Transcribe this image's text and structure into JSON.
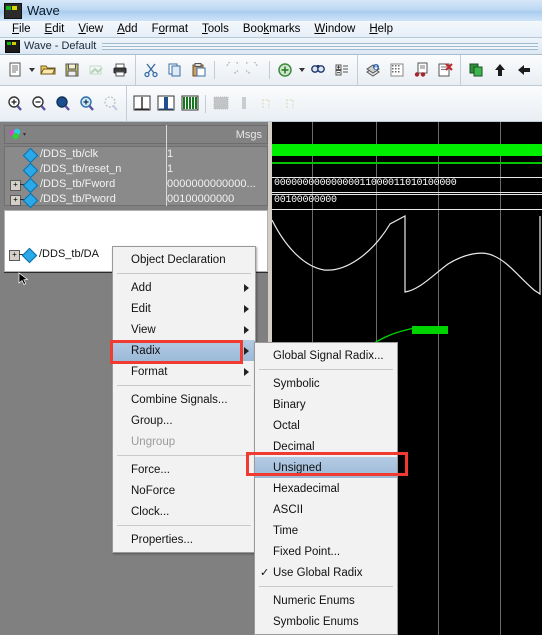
{
  "window": {
    "title": "Wave",
    "icon": "modelsim-icon",
    "document_tab": "Wave - Default"
  },
  "menubar": {
    "items": [
      {
        "label": "File",
        "mnemonic": "F"
      },
      {
        "label": "Edit",
        "mnemonic": "E"
      },
      {
        "label": "View",
        "mnemonic": "V"
      },
      {
        "label": "Add",
        "mnemonic": "A"
      },
      {
        "label": "Format",
        "mnemonic": "o"
      },
      {
        "label": "Tools",
        "mnemonic": "T"
      },
      {
        "label": "Bookmarks",
        "mnemonic": "k"
      },
      {
        "label": "Window",
        "mnemonic": "W"
      },
      {
        "label": "Help",
        "mnemonic": "H"
      }
    ]
  },
  "toolbar_main": {
    "icons": [
      "new-file-icon",
      "new-file-dropdown-icon",
      "open-folder-icon",
      "save-icon",
      "reload-icon",
      "print-icon",
      "cut-icon",
      "copy-icon",
      "paste-icon",
      "undo-icon",
      "redo-icon",
      "add-signal-icon",
      "add-signal-dropdown-icon",
      "find-icon",
      "expand-collapse-icon",
      "insert-wave-icon",
      "grid-icon",
      "annotate-icon",
      "delete-marker-icon",
      "copy-window-icon",
      "up-arrow-icon",
      "left-arrow-icon"
    ]
  },
  "toolbar_zoom": {
    "icons": [
      "zoom-in-icon",
      "zoom-out-icon",
      "zoom-full-icon",
      "zoom-cursor-icon",
      "zoom-range-icon",
      "cursor-icon",
      "wave-bar-icon",
      "wave-bars-icon",
      "dither-icon",
      "dither-small-icon",
      "step-icon",
      "step-alt-icon"
    ]
  },
  "wave_panel": {
    "header": {
      "msgs_label": "Msgs",
      "path_button": "path-selector-icon"
    },
    "signals": [
      {
        "name": "/DDS_tb/clk",
        "value": "1",
        "expandable": false,
        "wave_type": "bus-green"
      },
      {
        "name": "/DDS_tb/reset_n",
        "value": "1",
        "expandable": false,
        "wave_type": "bus-green"
      },
      {
        "name": "/DDS_tb/Fword",
        "value": "0000000000000...",
        "expandable": true,
        "wave_type": "bus"
      },
      {
        "name": "/DDS_tb/Pword",
        "value": "00100000000",
        "expandable": true,
        "wave_type": "bus"
      },
      {
        "name": "/DDS_tb/DA",
        "value": "",
        "expandable": true,
        "wave_type": "analog"
      }
    ],
    "wave_values": {
      "fword": "00000000000000011000011010100000",
      "pword": "00100000000"
    }
  },
  "context_menu": {
    "items": [
      {
        "label": "Object Declaration",
        "submenu": false,
        "disabled": false,
        "checked": false
      },
      {
        "separator": true
      },
      {
        "label": "Add",
        "submenu": true,
        "disabled": false,
        "checked": false
      },
      {
        "label": "Edit",
        "submenu": true,
        "disabled": false,
        "checked": false
      },
      {
        "label": "View",
        "submenu": true,
        "disabled": false,
        "checked": false
      },
      {
        "label": "Radix",
        "submenu": true,
        "disabled": false,
        "checked": false,
        "selected": true
      },
      {
        "label": "Format",
        "submenu": true,
        "disabled": false,
        "checked": false
      },
      {
        "separator": true
      },
      {
        "label": "Combine Signals...",
        "submenu": false,
        "disabled": false,
        "checked": false
      },
      {
        "label": "Group...",
        "submenu": false,
        "disabled": false,
        "checked": false
      },
      {
        "label": "Ungroup",
        "submenu": false,
        "disabled": true,
        "checked": false
      },
      {
        "separator": true
      },
      {
        "label": "Force...",
        "submenu": false,
        "disabled": false,
        "checked": false
      },
      {
        "label": "NoForce",
        "submenu": false,
        "disabled": false,
        "checked": false
      },
      {
        "label": "Clock...",
        "submenu": false,
        "disabled": false,
        "checked": false
      },
      {
        "separator": true
      },
      {
        "label": "Properties...",
        "submenu": false,
        "disabled": false,
        "checked": false
      }
    ]
  },
  "radix_submenu": {
    "items": [
      {
        "label": "Global Signal Radix...",
        "checked": false
      },
      {
        "separator": true
      },
      {
        "label": "Symbolic",
        "checked": false
      },
      {
        "label": "Binary",
        "checked": false
      },
      {
        "label": "Octal",
        "checked": false
      },
      {
        "label": "Decimal",
        "checked": false
      },
      {
        "label": "Unsigned",
        "checked": false,
        "selected": true
      },
      {
        "label": "Hexadecimal",
        "checked": false
      },
      {
        "label": "ASCII",
        "checked": false
      },
      {
        "label": "Time",
        "checked": false
      },
      {
        "label": "Fixed Point...",
        "checked": false
      },
      {
        "label": "Use Global Radix",
        "checked": true
      },
      {
        "separator": true
      },
      {
        "label": "Numeric Enums",
        "checked": false
      },
      {
        "label": "Symbolic Enums",
        "checked": false
      }
    ]
  },
  "annotations": {
    "highlight_color": "#f23b30",
    "boxes": [
      "radix-menu-item-highlight",
      "unsigned-menu-item-highlight"
    ]
  },
  "colors": {
    "wave_background": "#000000",
    "wave_trace": "#e8e8e8",
    "wave_active_green": "#00ee00",
    "panel_gray": "#808080",
    "menu_selected": "#9bb9d8"
  }
}
